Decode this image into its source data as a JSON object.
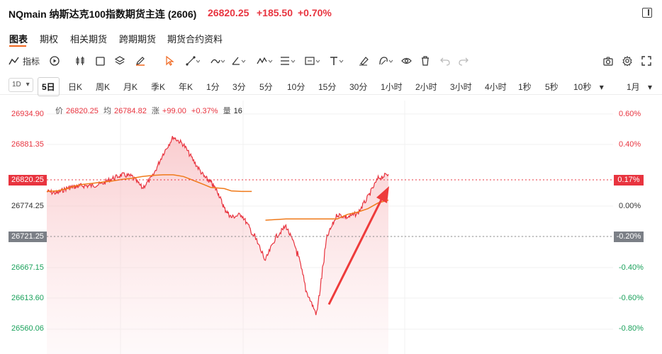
{
  "header": {
    "symbol": "NQmain 纳斯达克100指数期货主连 (2606)",
    "price": "26820.25",
    "change": "+185.50",
    "change_pct": "+0.70%"
  },
  "tabs": [
    "图表",
    "期权",
    "相关期货",
    "跨期期货",
    "期货合约资料"
  ],
  "toolbar": {
    "indicator_label": "指标"
  },
  "intervals": {
    "dropdown_left": "1D",
    "items": [
      "5日",
      "日K",
      "周K",
      "月K",
      "季K",
      "年K",
      "1分",
      "3分",
      "5分",
      "10分",
      "15分",
      "30分",
      "1小时",
      "2小时",
      "3小时",
      "4小时",
      "1秒",
      "5秒",
      "10秒"
    ],
    "active": "5日",
    "range": "1月"
  },
  "info": {
    "price_label": "价",
    "price": "26820.25",
    "avg_label": "均",
    "avg": "26784.82",
    "rise_label": "涨",
    "rise": "+99.00",
    "rise_pct": "+0.37%",
    "vol_label": "量",
    "vol": "16"
  },
  "axis": {
    "price_ticks": [
      "26934.90",
      "26881.35",
      "26774.25",
      "26667.15",
      "26613.60",
      "26560.06"
    ],
    "pct_ticks": [
      "0.60%",
      "0.40%",
      "0.00%",
      "-0.40%",
      "-0.60%",
      "-0.80%"
    ],
    "current_price_tag": "26820.25",
    "current_pct_tag": "0.17%",
    "ref_price_tag": "26721.25",
    "ref_pct_tag": "-0.20%"
  },
  "colors": {
    "up": "#e8343f",
    "down": "#1aa15b",
    "avg_line": "#f07a1a",
    "accent": "#f0661d"
  },
  "chart_data": {
    "type": "area",
    "title": "",
    "xlabel": "",
    "ylabel": "",
    "ylim": [
      26560.06,
      26934.9
    ],
    "x": [
      0,
      3,
      6,
      8,
      10,
      13,
      16,
      19,
      22,
      25,
      28,
      31,
      34,
      37,
      40,
      43,
      46,
      48,
      50,
      52,
      54,
      57,
      60,
      64,
      67,
      70,
      73,
      76,
      79,
      82,
      85,
      88,
      91,
      94,
      97,
      100
    ],
    "series": [
      {
        "values": [
          26800,
          26797,
          26806,
          26808,
          26810,
          26810,
          26813,
          26822,
          26829,
          26826,
          26806,
          26826,
          26865,
          26895,
          26882,
          26853,
          26826,
          26816,
          26800,
          26770,
          26755,
          26760,
          26730,
          26680,
          26720,
          26740,
          26700,
          26626,
          26585,
          26720,
          26760,
          26755,
          26762,
          26790,
          26823,
          26830
        ]
      },
      {
        "values": [
          26800,
          26801,
          26805,
          26809,
          26812,
          26814,
          26816,
          26818,
          26821,
          26823,
          26826,
          26828,
          26829,
          26829,
          26826,
          26819,
          26812,
          26807,
          26806,
          26805,
          26801,
          26800,
          26800,
          26750,
          26751,
          26752,
          26752,
          26752,
          26752,
          26752,
          26752,
          26760,
          26764,
          26770,
          26780,
          26785
        ]
      }
    ]
  }
}
